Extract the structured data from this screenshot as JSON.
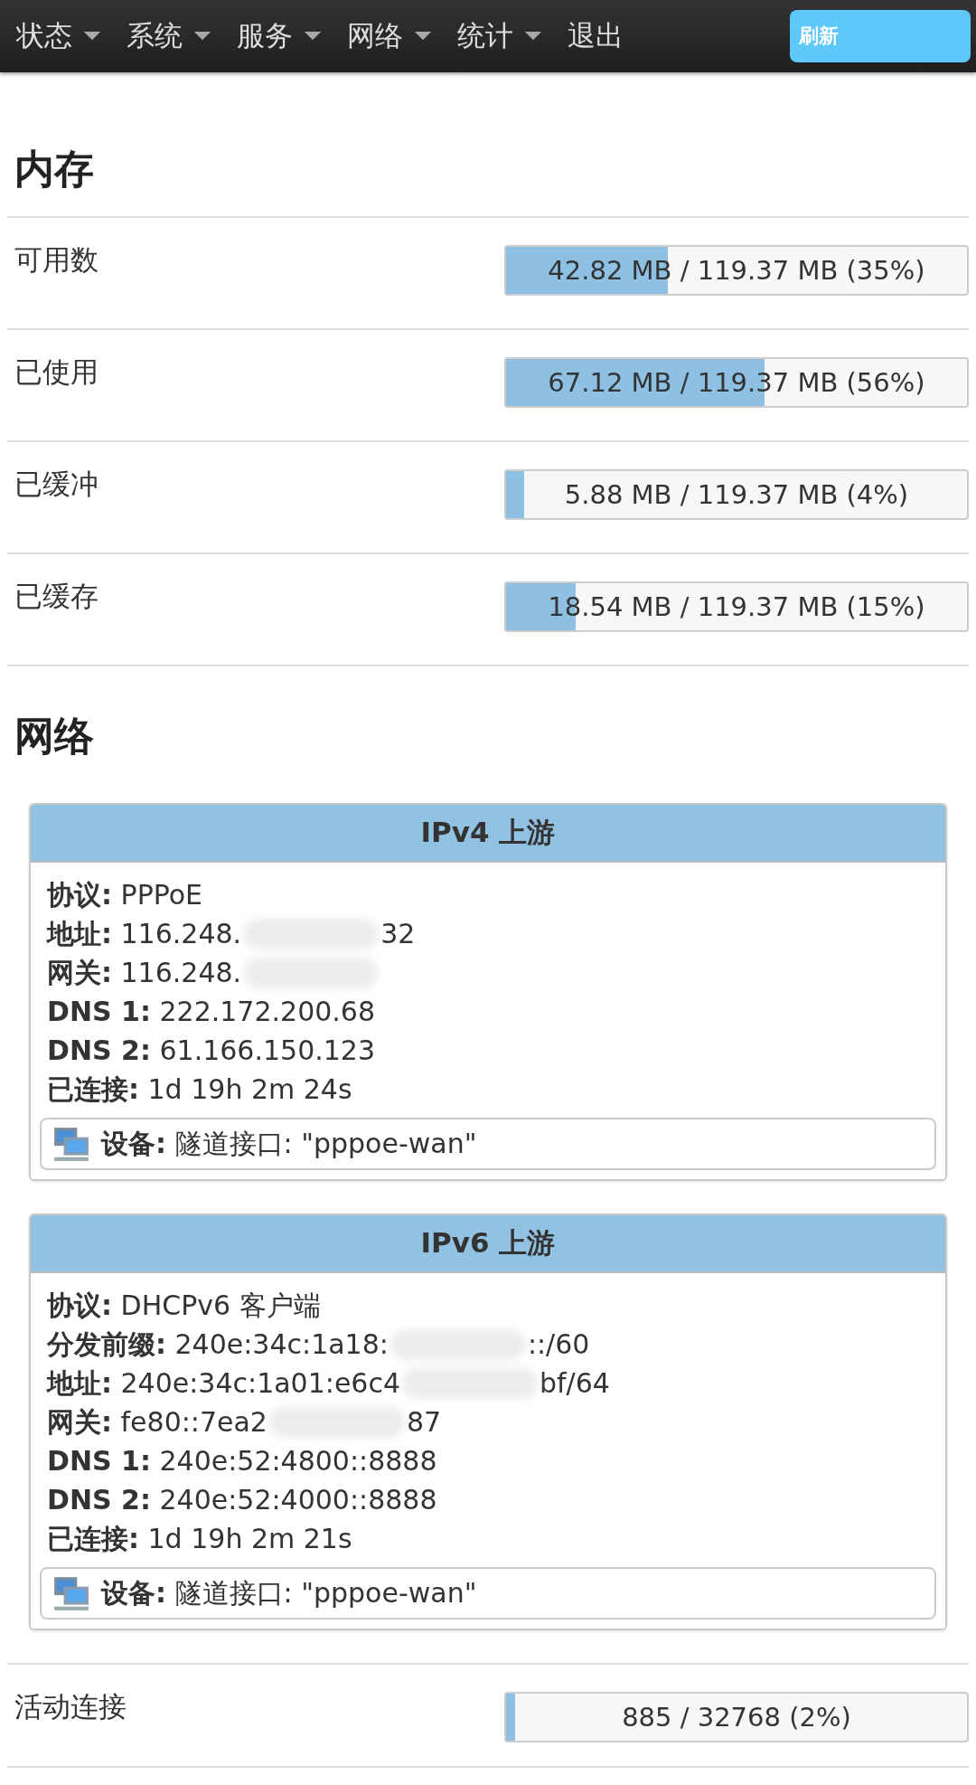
{
  "nav": {
    "items": [
      {
        "label": "状态",
        "dropdown": true
      },
      {
        "label": "系统",
        "dropdown": true
      },
      {
        "label": "服务",
        "dropdown": true
      },
      {
        "label": "网络",
        "dropdown": true
      },
      {
        "label": "统计",
        "dropdown": true
      },
      {
        "label": "退出",
        "dropdown": false
      }
    ],
    "refresh_button": "刷新"
  },
  "memory": {
    "title": "内存",
    "rows": [
      {
        "label": "可用数",
        "reading": "42.82 MB / 119.37 MB (35%)",
        "level": 0.35
      },
      {
        "label": "已使用",
        "reading": "67.12 MB / 119.37 MB (56%)",
        "level": 0.56
      },
      {
        "label": "已缓冲",
        "reading": "5.88 MB / 119.37 MB (4%)",
        "level": 0.04
      },
      {
        "label": "已缓存",
        "reading": "18.54 MB / 119.37 MB (15%)",
        "level": 0.15
      }
    ]
  },
  "network": {
    "title": "网络",
    "cards": [
      {
        "title": "IPv4 上游",
        "lines": [
          {
            "label": "协议:",
            "value": "PPPoE",
            "redacted": false
          },
          {
            "label": "地址:",
            "value": "116.248.",
            "redacted": true,
            "value_end": "32"
          },
          {
            "label": "网关:",
            "value": "116.248.",
            "redacted": true
          },
          {
            "label": "DNS 1:",
            "value": "222.172.200.68",
            "redacted": false
          },
          {
            "label": "DNS 2:",
            "value": "61.166.150.123",
            "redacted": false
          },
          {
            "label": "已连接:",
            "value": "1d 19h 2m 24s",
            "redacted": false
          }
        ],
        "device": {
          "label": "设备:",
          "value": "隧道接口: \"pppoe-wan\""
        }
      },
      {
        "title": "IPv6 上游",
        "lines": [
          {
            "label": "协议:",
            "value": "DHCPv6 客户端",
            "redacted": false
          },
          {
            "label": "分发前缀:",
            "value": "240e:34c:1a18:",
            "redacted": true,
            "value_end": "::/60"
          },
          {
            "label": "地址:",
            "value": "240e:34c:1a01:e6c4",
            "redacted": true,
            "value_end": "bf/64"
          },
          {
            "label": "网关:",
            "value": "fe80::7ea2",
            "redacted": true,
            "value_end": "87"
          },
          {
            "label": "DNS 1:",
            "value": "240e:52:4800::8888",
            "redacted": false
          },
          {
            "label": "DNS 2:",
            "value": "240e:52:4000::8888",
            "redacted": false
          },
          {
            "label": "已连接:",
            "value": "1d 19h 2m 21s",
            "redacted": false
          }
        ],
        "device": {
          "label": "设备:",
          "value": "隧道接口: \"pppoe-wan\""
        }
      }
    ]
  },
  "connections": {
    "label": "活动连接",
    "reading": "885 / 32768 (2%)",
    "level": 0.02
  }
}
